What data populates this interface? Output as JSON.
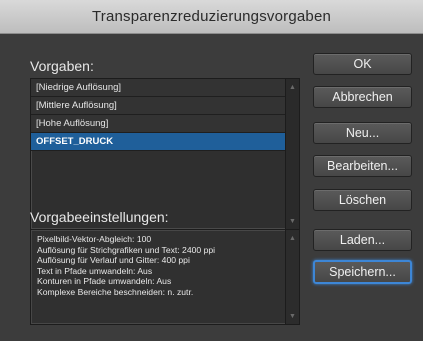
{
  "window": {
    "title": "Transparenzreduzierungsvorgaben"
  },
  "presets": {
    "label": "Vorgaben:",
    "items": [
      {
        "label": "[Niedrige Auflösung]",
        "selected": false
      },
      {
        "label": "[Mittlere Auflösung]",
        "selected": false
      },
      {
        "label": "[Hohe Auflösung]",
        "selected": false
      },
      {
        "label": "OFFSET_DRUCK",
        "selected": true
      }
    ]
  },
  "settings": {
    "label": "Vorgabeeinstellungen:",
    "lines": [
      "Pixelbild-Vektor-Abgleich: 100",
      "Auflösung für Strichgrafiken und Text: 2400 ppi",
      "Auflösung für Verlauf und Gitter: 400 ppi",
      "Text in Pfade umwandeln: Aus",
      "Konturen in Pfade umwandeln: Aus",
      "Komplexe Bereiche beschneiden: n. zutr."
    ]
  },
  "buttons": {
    "ok": "OK",
    "cancel": "Abbrechen",
    "new": "Neu...",
    "edit": "Bearbeiten...",
    "delete": "Löschen",
    "load": "Laden...",
    "save": "Speichern..."
  },
  "icons": {
    "scroll_up": "scroll-up-arrow",
    "scroll_down": "scroll-down-arrow"
  }
}
